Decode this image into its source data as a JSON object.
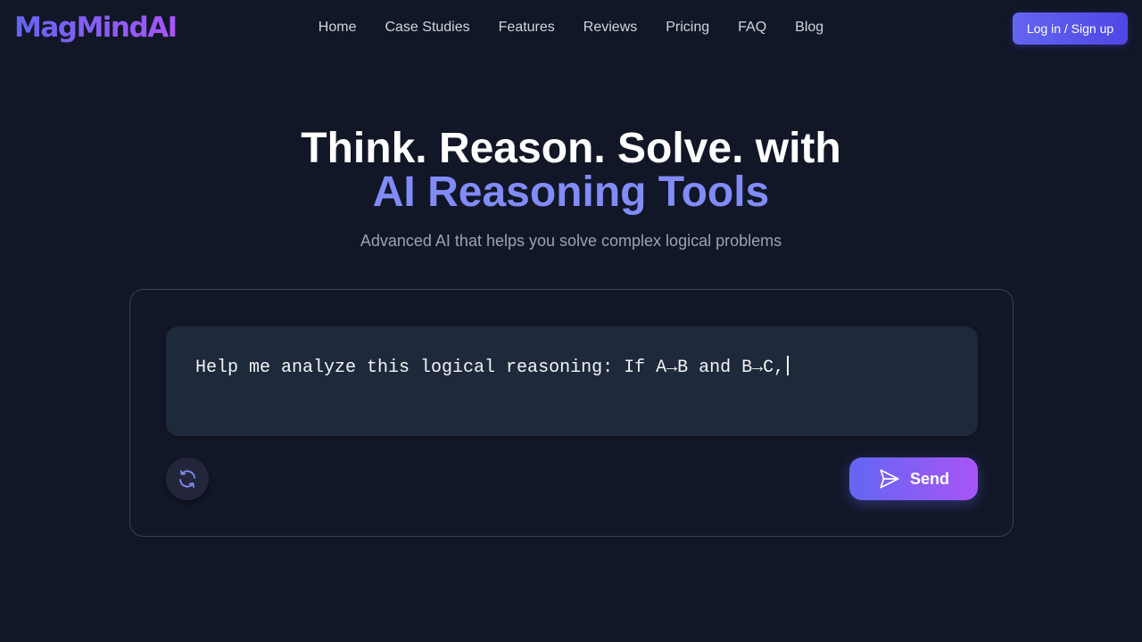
{
  "brand": {
    "name": "MagMindAI"
  },
  "nav": {
    "items": [
      {
        "label": "Home"
      },
      {
        "label": "Case Studies"
      },
      {
        "label": "Features"
      },
      {
        "label": "Reviews"
      },
      {
        "label": "Pricing"
      },
      {
        "label": "FAQ"
      },
      {
        "label": "Blog"
      }
    ],
    "login_label": "Log in / Sign up"
  },
  "hero": {
    "title_line1": "Think. Reason. Solve. with",
    "title_line2": "AI Reasoning Tools",
    "subtitle": "Advanced AI that helps you solve complex logical problems"
  },
  "composer": {
    "input_value": "Help me analyze this logical reasoning: If A→B and B→C,",
    "refresh_icon": "refresh-icon",
    "send_label": "Send",
    "send_icon": "send-icon"
  },
  "colors": {
    "background": "#111727",
    "accent": "#818cf8",
    "brand_gradient_start": "#6366f1",
    "brand_gradient_end": "#a855f7",
    "input_background": "#1e293b"
  }
}
